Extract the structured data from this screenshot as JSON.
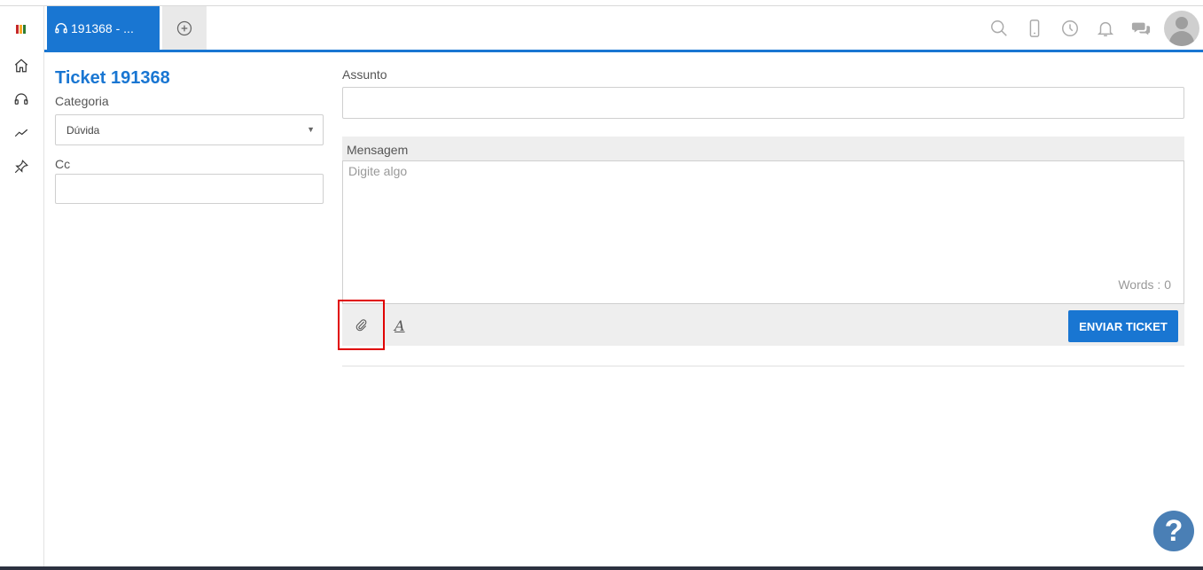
{
  "brand_colors": {
    "primary": "#1976d2",
    "logo": [
      "#c62828",
      "#f9a825",
      "#2e7d32"
    ]
  },
  "sidebar": {
    "items": [
      {
        "name": "home",
        "icon": "home-icon"
      },
      {
        "name": "tickets",
        "icon": "headset-icon"
      },
      {
        "name": "reports",
        "icon": "trend-icon"
      },
      {
        "name": "pinned",
        "icon": "pin-icon"
      }
    ]
  },
  "tabs": {
    "active_label": "191368 - ...",
    "active_icon": "headset-icon",
    "add_icon": "plus-circle-icon"
  },
  "top_icons": [
    "search-icon",
    "phone-icon",
    "clock-icon",
    "bell-icon",
    "chat-icon",
    "avatar"
  ],
  "ticket": {
    "title": "Ticket 191368",
    "category_label": "Categoria",
    "category_value": "Dúvida",
    "cc_label": "Cc",
    "cc_value": "",
    "subject_label": "Assunto",
    "subject_value": "",
    "message_label": "Mensagem",
    "message_placeholder": "Digite algo",
    "words_count": "Words : 0",
    "attach_icon": "paperclip-icon",
    "font_button": "A",
    "send_label": "ENVIAR TICKET"
  },
  "help_button": "?"
}
